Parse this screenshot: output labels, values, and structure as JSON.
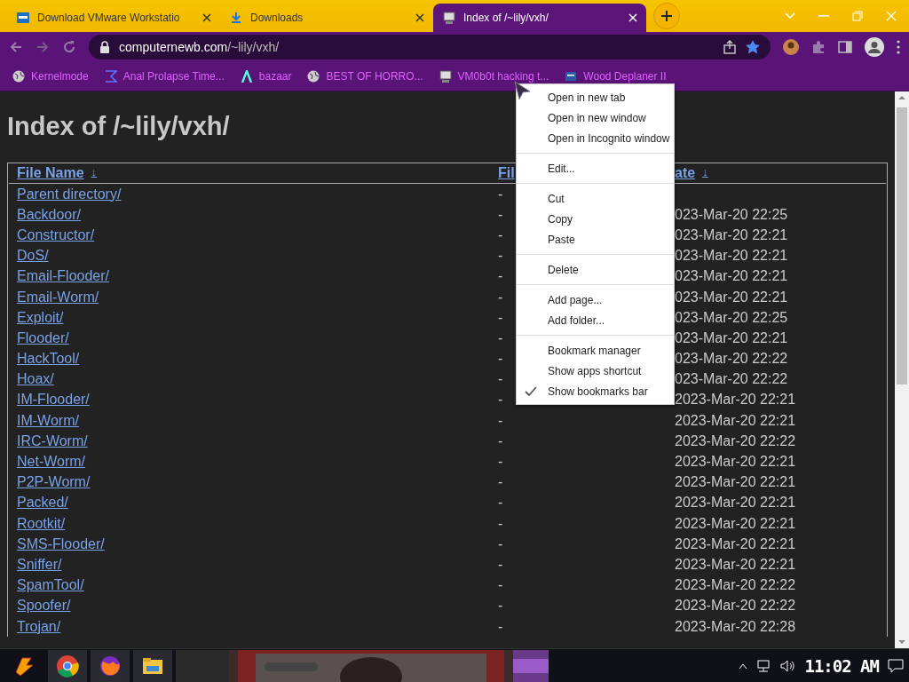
{
  "tabs": [
    {
      "title": "Download VMware Workstatio",
      "selected": false
    },
    {
      "title": "Downloads",
      "selected": false
    },
    {
      "title": "Index of /~lily/vxh/",
      "selected": true
    }
  ],
  "address_bar": {
    "domain": "computernewb.com",
    "path": "/~lily/vxh/",
    "bookmarked": true
  },
  "bookmarks": [
    "Kernelmode",
    "Anal Prolapse Time...",
    "bazaar",
    "BEST OF HORRO...",
    "VM0b0t hacking t...",
    "Wood Deplaner II"
  ],
  "page": {
    "heading": "Index of /~lily/vxh/",
    "table": {
      "columns": [
        "File Name",
        "Fil",
        "ate"
      ],
      "sort_arrow": "↓",
      "rows": [
        {
          "name": "Parent directory/",
          "size": "-",
          "date": ""
        },
        {
          "name": "Backdoor/",
          "size": "-",
          "date": "023-Mar-20 22:25"
        },
        {
          "name": "Constructor/",
          "size": "-",
          "date": "023-Mar-20 22:21"
        },
        {
          "name": "DoS/",
          "size": "-",
          "date": "023-Mar-20 22:21"
        },
        {
          "name": "Email-Flooder/",
          "size": "-",
          "date": "023-Mar-20 22:21"
        },
        {
          "name": "Email-Worm/",
          "size": "-",
          "date": "023-Mar-20 22:21"
        },
        {
          "name": "Exploit/",
          "size": "-",
          "date": "023-Mar-20 22:25"
        },
        {
          "name": "Flooder/",
          "size": "-",
          "date": "023-Mar-20 22:21"
        },
        {
          "name": "HackTool/",
          "size": "-",
          "date": "023-Mar-20 22:22"
        },
        {
          "name": "Hoax/",
          "size": "-",
          "date": "023-Mar-20 22:22"
        },
        {
          "name": "IM-Flooder/",
          "size": "-",
          "date": "2023-Mar-20 22:21"
        },
        {
          "name": "IM-Worm/",
          "size": "-",
          "date": "2023-Mar-20 22:21"
        },
        {
          "name": "IRC-Worm/",
          "size": "-",
          "date": "2023-Mar-20 22:22"
        },
        {
          "name": "Net-Worm/",
          "size": "-",
          "date": "2023-Mar-20 22:21"
        },
        {
          "name": "P2P-Worm/",
          "size": "-",
          "date": "2023-Mar-20 22:21"
        },
        {
          "name": "Packed/",
          "size": "-",
          "date": "2023-Mar-20 22:21"
        },
        {
          "name": "Rootkit/",
          "size": "-",
          "date": "2023-Mar-20 22:21"
        },
        {
          "name": "SMS-Flooder/",
          "size": "-",
          "date": "2023-Mar-20 22:21"
        },
        {
          "name": "Sniffer/",
          "size": "-",
          "date": "2023-Mar-20 22:21"
        },
        {
          "name": "SpamTool/",
          "size": "-",
          "date": "2023-Mar-20 22:22"
        },
        {
          "name": "Spoofer/",
          "size": "-",
          "date": "2023-Mar-20 22:22"
        },
        {
          "name": "Trojan/",
          "size": "-",
          "date": "2023-Mar-20 22:28"
        }
      ]
    }
  },
  "context_menu": {
    "groups": [
      [
        {
          "label": "Open in new tab",
          "checked": false
        },
        {
          "label": "Open in new window",
          "checked": false
        },
        {
          "label": "Open in Incognito window",
          "checked": false
        }
      ],
      [
        {
          "label": "Edit...",
          "checked": false
        }
      ],
      [
        {
          "label": "Cut",
          "checked": false
        },
        {
          "label": "Copy",
          "checked": false
        },
        {
          "label": "Paste",
          "checked": false
        }
      ],
      [
        {
          "label": "Delete",
          "checked": false
        }
      ],
      [
        {
          "label": "Add page...",
          "checked": false
        },
        {
          "label": "Add folder...",
          "checked": false
        }
      ],
      [
        {
          "label": "Bookmark manager",
          "checked": false
        },
        {
          "label": "Show apps shortcut",
          "checked": false
        },
        {
          "label": "Show bookmarks bar",
          "checked": true
        }
      ]
    ]
  },
  "taskbar": {
    "clock": "11:02 AM"
  }
}
